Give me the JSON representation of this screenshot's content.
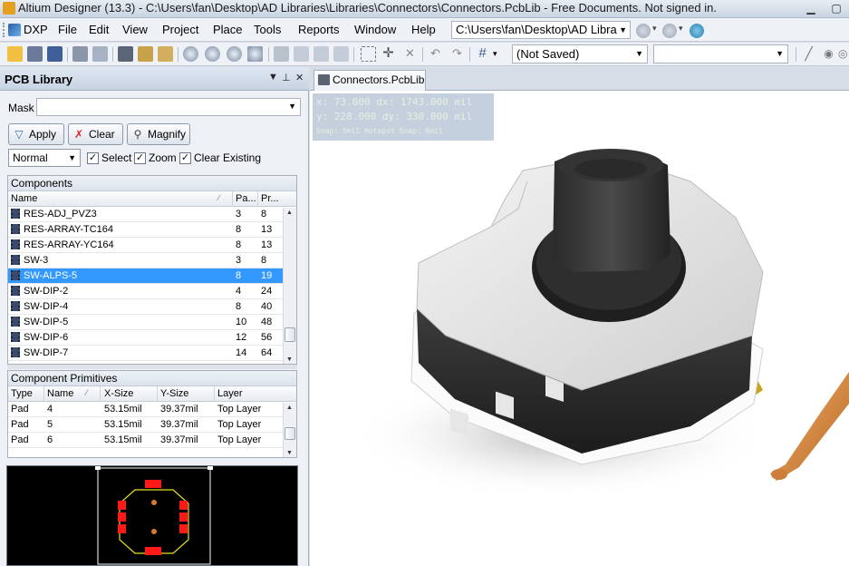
{
  "window": {
    "title": "Altium Designer (13.3) - C:\\Users\\fan\\Desktop\\AD Libraries\\Libraries\\Connectors\\Connectors.PcbLib - Free Documents. Not signed in."
  },
  "menubar": {
    "items": [
      "DXP",
      "File",
      "Edit",
      "View",
      "Project",
      "Place",
      "Tools",
      "Reports",
      "Window",
      "Help"
    ],
    "path": "C:\\Users\\fan\\Desktop\\AD Libra"
  },
  "toolbar": {
    "variant_combo": "(Not Saved)",
    "second_combo": ""
  },
  "panel": {
    "title": "PCB Library",
    "mask_label": "Mask",
    "mask_value": "",
    "apply": "Apply",
    "clear": "Clear",
    "magnify": "Magnify",
    "mode": "Normal",
    "select": "Select",
    "zoom": "Zoom",
    "clear_existing": "Clear Existing",
    "components": {
      "title": "Components",
      "headers": [
        "Name",
        "Pa...",
        "Pr..."
      ],
      "rows": [
        {
          "name": "RES-ADJ_PVZ3",
          "pads": "3",
          "prims": "8"
        },
        {
          "name": "RES-ARRAY-TC164",
          "pads": "8",
          "prims": "13"
        },
        {
          "name": "RES-ARRAY-YC164",
          "pads": "8",
          "prims": "13"
        },
        {
          "name": "SW-3",
          "pads": "3",
          "prims": "8"
        },
        {
          "name": "SW-ALPS-5",
          "pads": "8",
          "prims": "19",
          "selected": true
        },
        {
          "name": "SW-DIP-2",
          "pads": "4",
          "prims": "24"
        },
        {
          "name": "SW-DIP-4",
          "pads": "8",
          "prims": "40"
        },
        {
          "name": "SW-DIP-5",
          "pads": "10",
          "prims": "48"
        },
        {
          "name": "SW-DIP-6",
          "pads": "12",
          "prims": "56"
        },
        {
          "name": "SW-DIP-7",
          "pads": "14",
          "prims": "64"
        }
      ]
    },
    "primitives": {
      "title": "Component Primitives",
      "headers": [
        "Type",
        "Name",
        "X-Size",
        "Y-Size",
        "Layer"
      ],
      "rows": [
        {
          "type": "Pad",
          "name": "4",
          "xsize": "53.15mil",
          "ysize": "39.37mil",
          "layer": "Top Layer"
        },
        {
          "type": "Pad",
          "name": "5",
          "xsize": "53.15mil",
          "ysize": "39.37mil",
          "layer": "Top Layer"
        },
        {
          "type": "Pad",
          "name": "6",
          "xsize": "53.15mil",
          "ysize": "39.37mil",
          "layer": "Top Layer"
        }
      ]
    }
  },
  "document": {
    "tab": "Connectors.PcbLib",
    "hud": {
      "line1": "x:   73.000   dx: 1743.000 mil",
      "line2": "y:  228.000   dy:  330.000 mil",
      "line3": "Snap: 5mil Hotspot Snap: 8mil"
    }
  },
  "colors": {
    "selection": "#3399ff",
    "pad_red": "#ff1a1a",
    "outline_yellow": "#e5e020",
    "gold": "#c9a41a"
  }
}
